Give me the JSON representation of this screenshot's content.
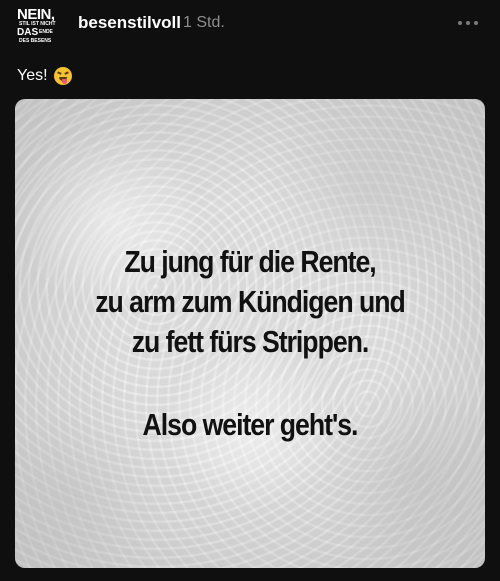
{
  "post": {
    "avatar": {
      "line1": "NEIN,",
      "line2": "STIL IST NICHT",
      "line3": "DAS",
      "line4": "ENDE",
      "line5": "DES BESENS"
    },
    "username": "besenstilvoll",
    "timestamp": "1 Std.",
    "more_icon": "more-horizontal-icon",
    "caption": "Yes!",
    "caption_emoji": "squinting-face-with-tongue-icon",
    "image": {
      "lines": [
        "Zu jung für die Rente,",
        "zu arm zum Kündigen und",
        "zu fett fürs Strippen.",
        "Also weiter geht's."
      ]
    }
  },
  "colors": {
    "background": "#0f0f0f",
    "text": "#ffffff",
    "muted": "#8d8d8d",
    "image_background": "#e7e7e7",
    "meme_text": "#111111"
  }
}
